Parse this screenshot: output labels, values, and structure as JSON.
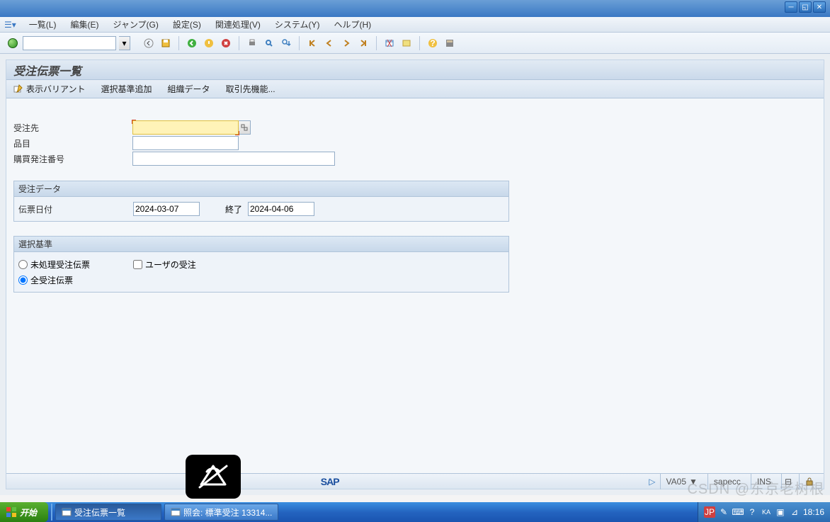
{
  "menu": {
    "list": "一覧(L)",
    "edit": "編集(E)",
    "jump": "ジャンプ(G)",
    "settings": "設定(S)",
    "related": "関連処理(V)",
    "system": "システム(Y)",
    "help": "ヘルプ(H)"
  },
  "panel": {
    "title": "受注伝票一覧"
  },
  "appbar": {
    "variant": "表示バリアント",
    "addcrit": "選択基準追加",
    "orgdata": "組織データ",
    "partner": "取引先機能..."
  },
  "fields": {
    "soldto": "受注先",
    "material": "品目",
    "po": "購買発注番号"
  },
  "group1": {
    "title": "受注データ",
    "docdate": "伝票日付",
    "from": "2024-03-07",
    "tolbl": "終了",
    "to": "2024-04-06"
  },
  "group2": {
    "title": "選択基準",
    "open": "未処理受注伝票",
    "user": "ユーザの受注",
    "all": "全受注伝票"
  },
  "status": {
    "tcode": "VA05",
    "server": "sapecc",
    "mode": "INS"
  },
  "taskbar": {
    "start": "开始",
    "t1": "受注伝票一覧",
    "t2": "照会: 標準受注 13314...",
    "ime": "JP",
    "clock": "18:16"
  },
  "watermark": "CSDN @东京老树根"
}
